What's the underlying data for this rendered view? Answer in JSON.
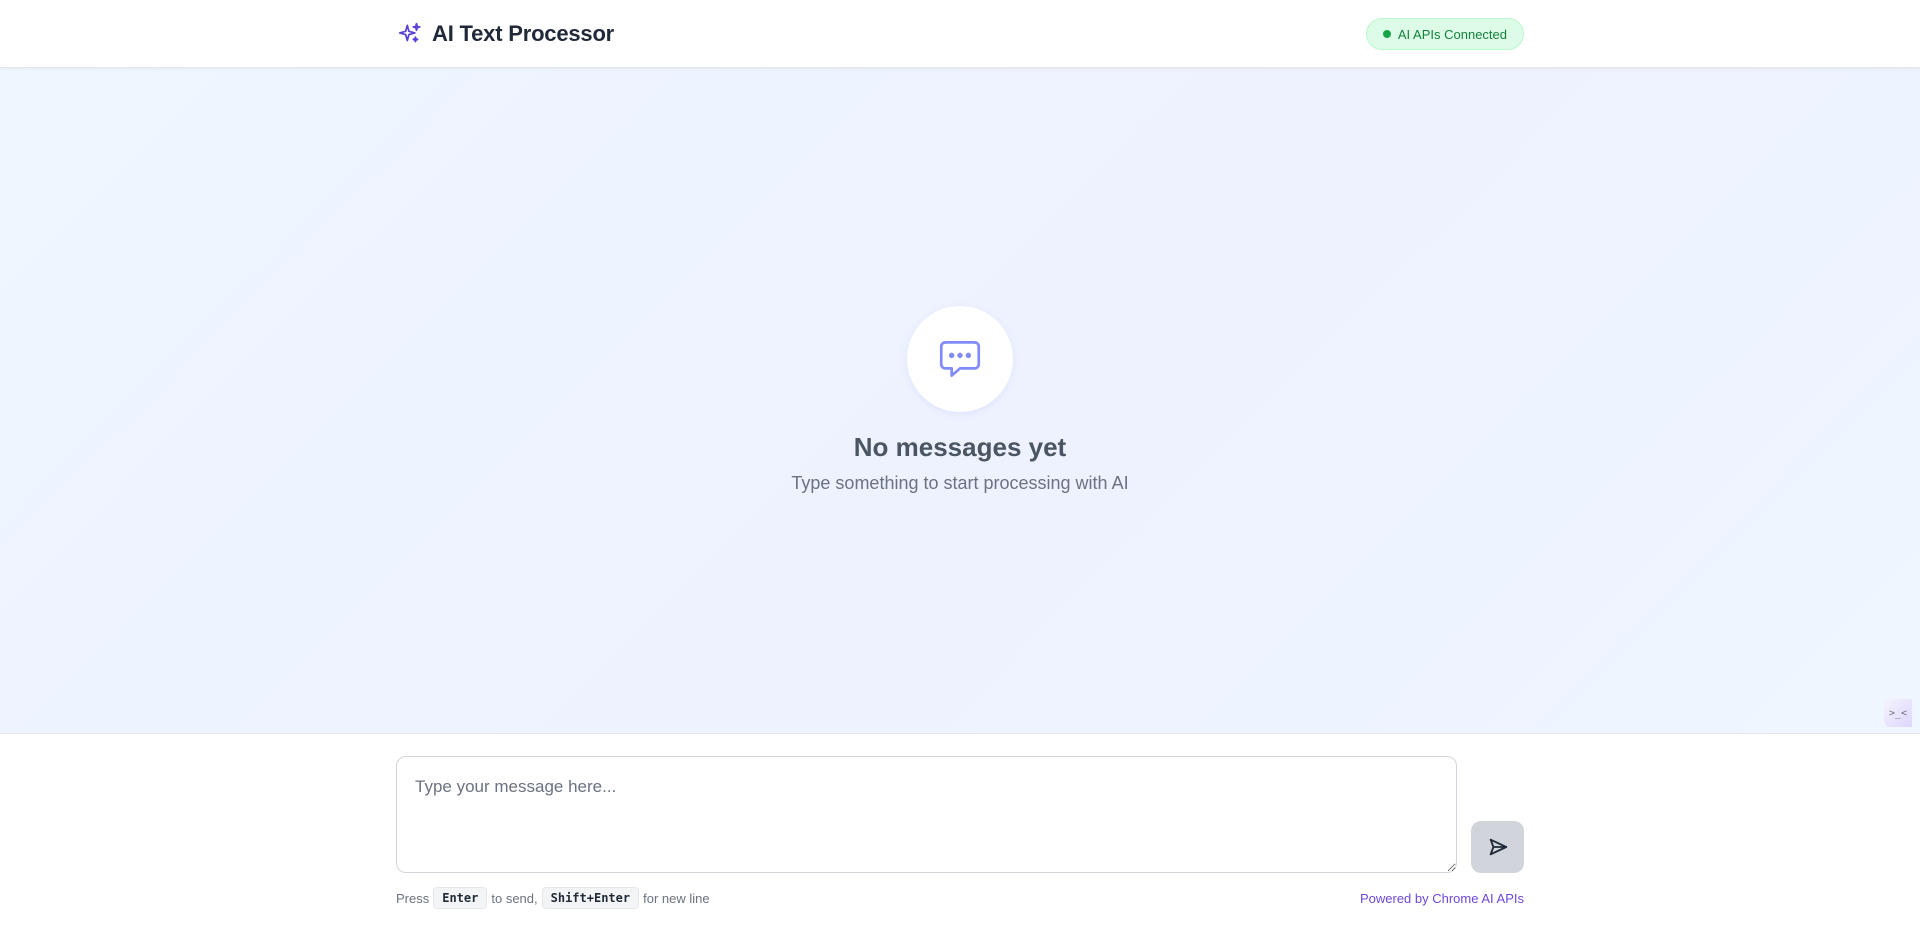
{
  "header": {
    "title": "AI Text Processor",
    "logo_icon": "sparkles-icon",
    "status": "AI APIs Connected"
  },
  "empty_state": {
    "icon": "chat-bubble-icon",
    "title": "No messages yet",
    "subtitle": "Type something to start processing with AI"
  },
  "devtools": {
    "label": ">_<"
  },
  "composer": {
    "placeholder": "Type your message here...",
    "send_icon": "send-icon",
    "hint_press": "Press",
    "hint_enter": "Enter",
    "hint_to_send": "to send,",
    "hint_shift_enter": "Shift+Enter",
    "hint_new_line": "for new line",
    "powered_by": "Powered by Chrome AI APIs"
  },
  "colors": {
    "accent": "#6d48d9",
    "status_green": "#15803d",
    "background_tint": "#eef2ff"
  }
}
